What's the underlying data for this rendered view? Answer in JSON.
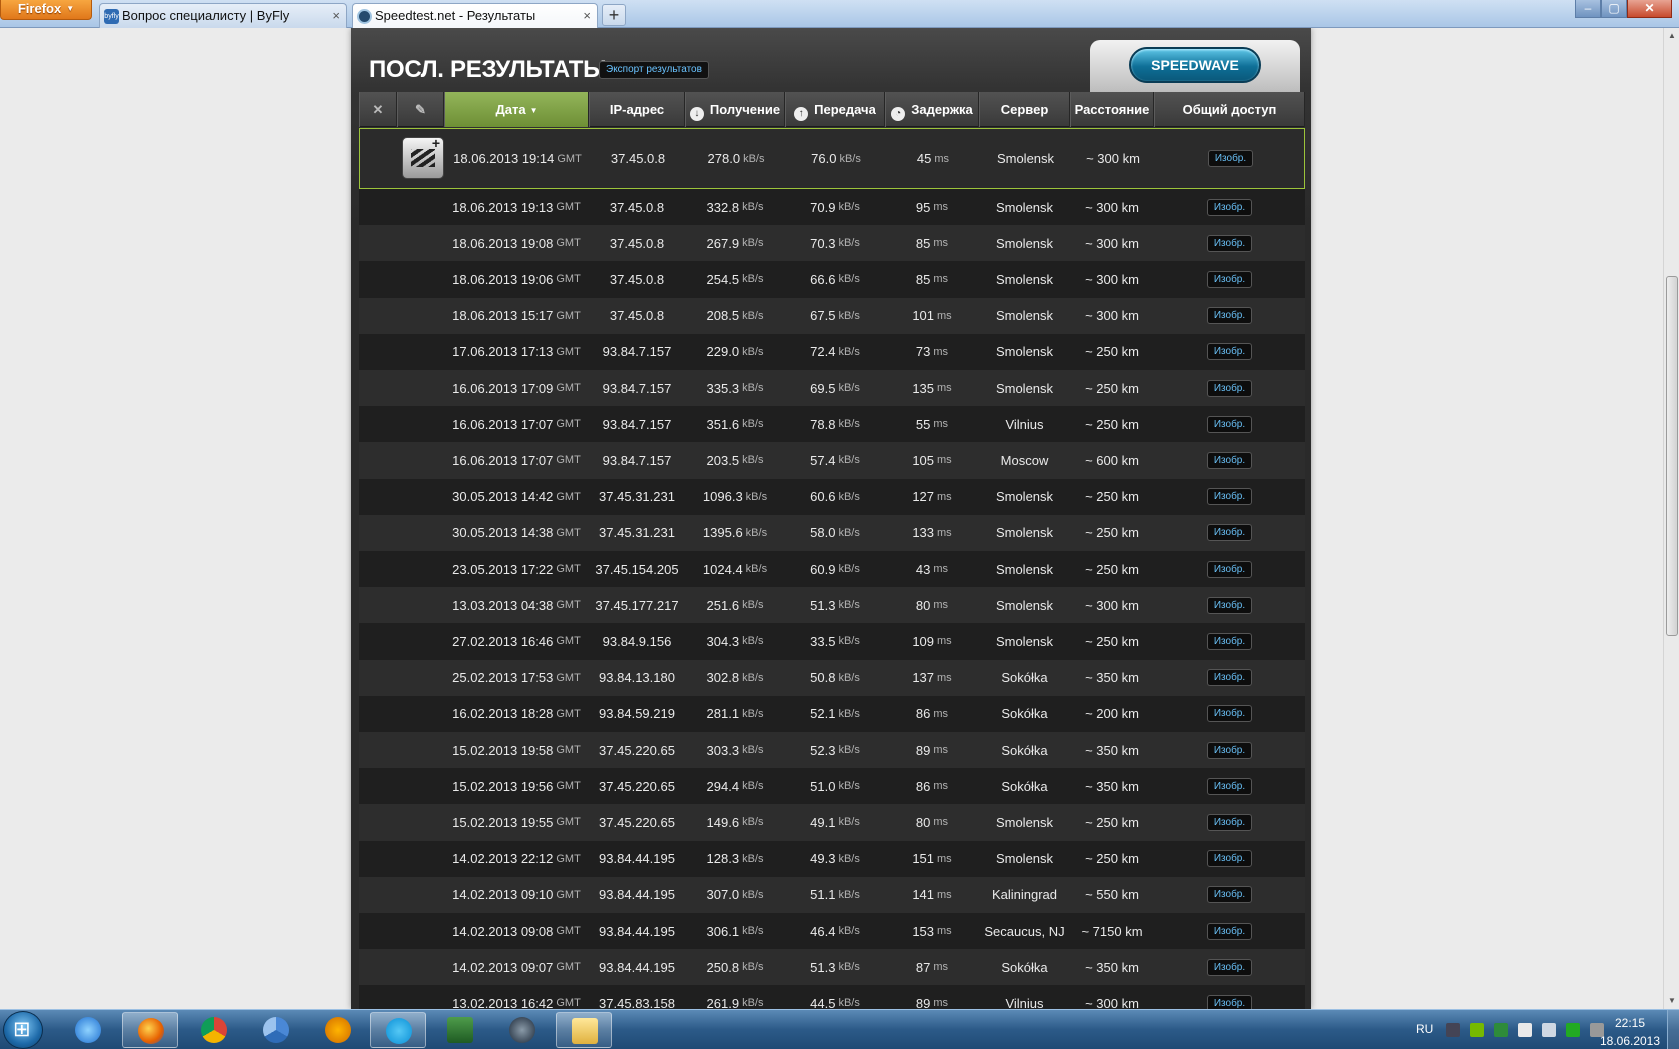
{
  "browser": {
    "menu_label": "Firefox",
    "tabs": [
      {
        "title": "Вопрос специалисту | ByFly",
        "favicon_text": "byfly"
      },
      {
        "title": "Speedtest.net - Результаты"
      }
    ],
    "new_tab_label": "+",
    "close_tab": "×",
    "window_buttons": {
      "minimize": "–",
      "maximize": "▢",
      "close": "✕"
    }
  },
  "page": {
    "title": "ПОСЛ. РЕЗУЛЬТАТЫ",
    "export_label": "Экспорт результатов",
    "speedwave_label": "SPEEDWAVE",
    "columns": {
      "delete_icon": "✕",
      "edit_icon": "✎",
      "date": "Дата",
      "ip": "IP-адрес",
      "download": "Получение",
      "upload": "Передача",
      "latency": "Задержка",
      "server": "Сервер",
      "distance": "Расстояние",
      "share": "Общий доступ"
    },
    "units": {
      "tz": "GMT",
      "speed": "kB/s",
      "latency": "ms"
    },
    "image_button_label": "Изобр.",
    "rows": [
      {
        "date": "18.06.2013 19:14",
        "ip": "37.45.0.8",
        "down": "278.0",
        "up": "76.0",
        "lat": "45",
        "server": "Smolensk",
        "dist": "~ 300 km"
      },
      {
        "date": "18.06.2013 19:13",
        "ip": "37.45.0.8",
        "down": "332.8",
        "up": "70.9",
        "lat": "95",
        "server": "Smolensk",
        "dist": "~ 300 km"
      },
      {
        "date": "18.06.2013 19:08",
        "ip": "37.45.0.8",
        "down": "267.9",
        "up": "70.3",
        "lat": "85",
        "server": "Smolensk",
        "dist": "~ 300 km"
      },
      {
        "date": "18.06.2013 19:06",
        "ip": "37.45.0.8",
        "down": "254.5",
        "up": "66.6",
        "lat": "85",
        "server": "Smolensk",
        "dist": "~ 300 km"
      },
      {
        "date": "18.06.2013 15:17",
        "ip": "37.45.0.8",
        "down": "208.5",
        "up": "67.5",
        "lat": "101",
        "server": "Smolensk",
        "dist": "~ 300 km"
      },
      {
        "date": "17.06.2013 17:13",
        "ip": "93.84.7.157",
        "down": "229.0",
        "up": "72.4",
        "lat": "73",
        "server": "Smolensk",
        "dist": "~ 250 km"
      },
      {
        "date": "16.06.2013 17:09",
        "ip": "93.84.7.157",
        "down": "335.3",
        "up": "69.5",
        "lat": "135",
        "server": "Smolensk",
        "dist": "~ 250 km"
      },
      {
        "date": "16.06.2013 17:07",
        "ip": "93.84.7.157",
        "down": "351.6",
        "up": "78.8",
        "lat": "55",
        "server": "Vilnius",
        "dist": "~ 250 km"
      },
      {
        "date": "16.06.2013 17:07",
        "ip": "93.84.7.157",
        "down": "203.5",
        "up": "57.4",
        "lat": "105",
        "server": "Moscow",
        "dist": "~ 600 km"
      },
      {
        "date": "30.05.2013 14:42",
        "ip": "37.45.31.231",
        "down": "1096.3",
        "up": "60.6",
        "lat": "127",
        "server": "Smolensk",
        "dist": "~ 250 km"
      },
      {
        "date": "30.05.2013 14:38",
        "ip": "37.45.31.231",
        "down": "1395.6",
        "up": "58.0",
        "lat": "133",
        "server": "Smolensk",
        "dist": "~ 250 km"
      },
      {
        "date": "23.05.2013 17:22",
        "ip": "37.45.154.205",
        "down": "1024.4",
        "up": "60.9",
        "lat": "43",
        "server": "Smolensk",
        "dist": "~ 250 km"
      },
      {
        "date": "13.03.2013 04:38",
        "ip": "37.45.177.217",
        "down": "251.6",
        "up": "51.3",
        "lat": "80",
        "server": "Smolensk",
        "dist": "~ 300 km"
      },
      {
        "date": "27.02.2013 16:46",
        "ip": "93.84.9.156",
        "down": "304.3",
        "up": "33.5",
        "lat": "109",
        "server": "Smolensk",
        "dist": "~ 250 km"
      },
      {
        "date": "25.02.2013 17:53",
        "ip": "93.84.13.180",
        "down": "302.8",
        "up": "50.8",
        "lat": "137",
        "server": "Sokółka",
        "dist": "~ 350 km"
      },
      {
        "date": "16.02.2013 18:28",
        "ip": "93.84.59.219",
        "down": "281.1",
        "up": "52.1",
        "lat": "86",
        "server": "Sokółka",
        "dist": "~ 200 km"
      },
      {
        "date": "15.02.2013 19:58",
        "ip": "37.45.220.65",
        "down": "303.3",
        "up": "52.3",
        "lat": "89",
        "server": "Sokółka",
        "dist": "~ 350 km"
      },
      {
        "date": "15.02.2013 19:56",
        "ip": "37.45.220.65",
        "down": "294.4",
        "up": "51.0",
        "lat": "86",
        "server": "Sokółka",
        "dist": "~ 350 km"
      },
      {
        "date": "15.02.2013 19:55",
        "ip": "37.45.220.65",
        "down": "149.6",
        "up": "49.1",
        "lat": "80",
        "server": "Smolensk",
        "dist": "~ 250 km"
      },
      {
        "date": "14.02.2013 22:12",
        "ip": "93.84.44.195",
        "down": "128.3",
        "up": "49.3",
        "lat": "151",
        "server": "Smolensk",
        "dist": "~ 250 km"
      },
      {
        "date": "14.02.2013 09:10",
        "ip": "93.84.44.195",
        "down": "307.0",
        "up": "51.1",
        "lat": "141",
        "server": "Kaliningrad",
        "dist": "~ 550 km"
      },
      {
        "date": "14.02.2013 09:08",
        "ip": "93.84.44.195",
        "down": "306.1",
        "up": "46.4",
        "lat": "153",
        "server": "Secaucus, NJ",
        "dist": "~ 7150 km"
      },
      {
        "date": "14.02.2013 09:07",
        "ip": "93.84.44.195",
        "down": "250.8",
        "up": "51.3",
        "lat": "87",
        "server": "Sokółka",
        "dist": "~ 350 km"
      },
      {
        "date": "13.02.2013 16:42",
        "ip": "37.45.83.158",
        "down": "261.9",
        "up": "44.5",
        "lat": "89",
        "server": "Vilnius",
        "dist": "~ 300 km"
      }
    ]
  },
  "taskbar": {
    "apps": [
      "internet-explorer",
      "firefox",
      "chrome",
      "chromium",
      "aimp",
      "skype",
      "system-monitor",
      "steam",
      "explorer"
    ],
    "language": "RU",
    "clock_time": "22:15",
    "clock_date": "18.06.2013"
  },
  "colors": {
    "accent_green": "#9cc43a",
    "link_blue": "#69bff5",
    "speedwave": "#0e6f97"
  }
}
